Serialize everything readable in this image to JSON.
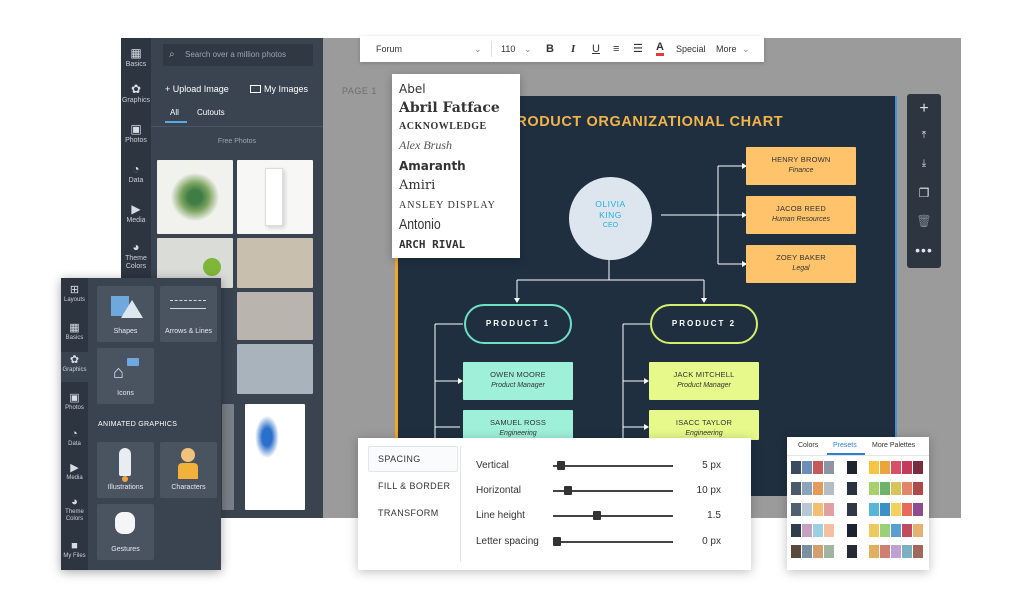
{
  "nav_rail": {
    "items": [
      {
        "label": "Basics",
        "icon": "grid-icon"
      },
      {
        "label": "Graphics",
        "icon": "graphics-icon"
      },
      {
        "label": "Photos",
        "icon": "photo-icon"
      },
      {
        "label": "Data",
        "icon": "pie-icon"
      },
      {
        "label": "Media",
        "icon": "media-icon"
      },
      {
        "label": "Theme Colors",
        "icon": "palette-icon"
      }
    ]
  },
  "photos_panel": {
    "search_placeholder": "Search over a million photos",
    "upload_label": "+ Upload Image",
    "my_images_label": "My Images",
    "tabs": [
      "All",
      "Cutouts"
    ],
    "section_label": "Free Photos"
  },
  "canvas": {
    "page_label": "PAGE 1",
    "chart_title": "PRODUCT ORGANIZATIONAL CHART",
    "ceo": {
      "name": "OLIVIA\nKING",
      "role": "CEO"
    },
    "right_boxes": [
      {
        "name": "HENRY BROWN",
        "role": "Finance"
      },
      {
        "name": "JACOB REED",
        "role": "Human Resources"
      },
      {
        "name": "ZOEY BAKER",
        "role": "Legal"
      }
    ],
    "products": [
      "PRODUCT 1",
      "PRODUCT 2"
    ],
    "product1_members": [
      {
        "name": "OWEN MOORE",
        "role": "Product Manager"
      },
      {
        "name": "SAMUEL ROSS",
        "role": "Engineering"
      }
    ],
    "product2_members": [
      {
        "name": "JACK MITCHELL",
        "role": "Product Manager"
      },
      {
        "name": "ISACC TAYLOR",
        "role": "Engineering"
      }
    ]
  },
  "tool_rail": {
    "icons": [
      "plus-icon",
      "move-up-icon",
      "move-down-icon",
      "copy-icon",
      "trash-icon",
      "more-icon"
    ]
  },
  "font_toolbar": {
    "font": "Forum",
    "size": "110",
    "bold": "B",
    "italic": "I",
    "underline": "U",
    "color_letter": "A",
    "special": "Special",
    "more": "More"
  },
  "font_dropdown": {
    "options": [
      "Abel",
      "Abril Fatface",
      "ACKNOWLEDGE",
      "Alex Brush",
      "Amaranth",
      "Amiri",
      "ANSLEY DISPLAY",
      "Antonio",
      "ARCH RIVAL"
    ]
  },
  "graphics_panel": {
    "rail": [
      {
        "label": "Layouts",
        "icon": "layout-icon"
      },
      {
        "label": "Basics",
        "icon": "basics-icon"
      },
      {
        "label": "Graphics",
        "icon": "graphics-icon"
      },
      {
        "label": "Photos",
        "icon": "photo-icon"
      },
      {
        "label": "Data",
        "icon": "pie-icon"
      },
      {
        "label": "Media",
        "icon": "media-icon"
      },
      {
        "label": "Theme Colors",
        "icon": "palette-icon"
      },
      {
        "label": "My Files",
        "icon": "folder-icon"
      }
    ],
    "tiles": [
      "Shapes",
      "Arrows & Lines",
      "Icons"
    ],
    "animated_heading": "ANIMATED GRAPHICS",
    "animated_tiles": [
      "Illustrations",
      "Characters",
      "Gestures"
    ]
  },
  "spacing_panel": {
    "menu": [
      "SPACING",
      "FILL & BORDER",
      "TRANSFORM"
    ],
    "rows": [
      {
        "label": "Vertical",
        "value": "5 px",
        "level": 0.04
      },
      {
        "label": "Horizontal",
        "value": "10 px",
        "level": 0.1
      },
      {
        "label": "Line height",
        "value": "1.5",
        "level": 0.36
      },
      {
        "label": "Letter spacing",
        "value": "0 px",
        "level": 0
      }
    ]
  },
  "colors_panel": {
    "tabs": [
      "Colors",
      "Presets",
      "More Palettes"
    ],
    "active_tab": "Presets"
  }
}
